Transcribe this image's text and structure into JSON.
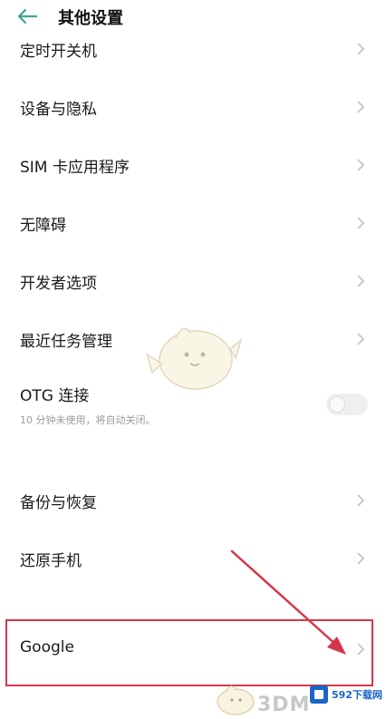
{
  "header": {
    "title": "其他设置",
    "back_icon": "arrow-left-icon"
  },
  "items": [
    {
      "label": "定时开关机"
    },
    {
      "label": "设备与隐私"
    },
    {
      "label": "SIM 卡应用程序"
    },
    {
      "label": "无障碍"
    },
    {
      "label": "开发者选项"
    },
    {
      "label": "最近任务管理"
    },
    {
      "label": "OTG 连接",
      "sub": "10 分钟未使用，将自动关闭。",
      "toggle_on": false
    },
    {
      "label": "备份与恢复"
    },
    {
      "label": "还原手机"
    },
    {
      "label": "Google"
    }
  ],
  "watermarks": {
    "brand_3dm": "3DM",
    "site_logo": "592下载网"
  },
  "colors": {
    "accent": "#3aa890",
    "highlight": "#d6364a",
    "site_blue": "#1b64c8"
  }
}
